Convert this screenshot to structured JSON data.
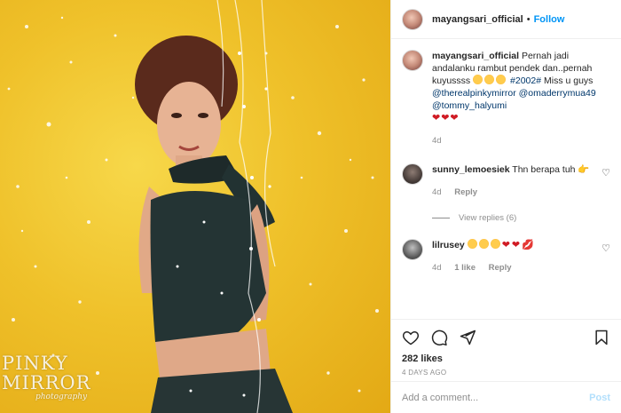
{
  "photo": {
    "watermark_main": "PINKY\nMIRROR",
    "watermark_line1": "PINKY",
    "watermark_line2": "MIRROR",
    "watermark_script": "photography"
  },
  "header": {
    "username": "mayangsari_official",
    "separator": "•",
    "follow_label": "Follow",
    "more": "•••"
  },
  "caption": {
    "username": "mayangsari_official",
    "text": "Pernah jadi andalanku rambut pendek dan..pernah kuyussss",
    "hashtag": "#2002#",
    "text2": "Miss u guys",
    "mention1": "@therealpinkymirror",
    "mention2": "@omaderrymua49",
    "mention3": "@tommy_halyumi",
    "hearts": "❤❤❤",
    "time": "4d"
  },
  "comments": [
    {
      "username": "sunny_lemoesiek",
      "text": "Thn berapa tuh",
      "emoji": "👉",
      "time": "4d",
      "reply_label": "Reply",
      "view_replies": "View replies (6)"
    },
    {
      "username": "lilrusey",
      "time": "4d",
      "likes": "1 like",
      "reply_label": "Reply"
    }
  ],
  "actions": {
    "likes": "282 likes",
    "posted_ago": "4 DAYS AGO"
  },
  "add_comment": {
    "placeholder": "Add a comment...",
    "post_label": "Post"
  },
  "colors": {
    "accent": "#0095f6",
    "photo_bg": "#efc12a",
    "heart_red": "#d01b24"
  }
}
